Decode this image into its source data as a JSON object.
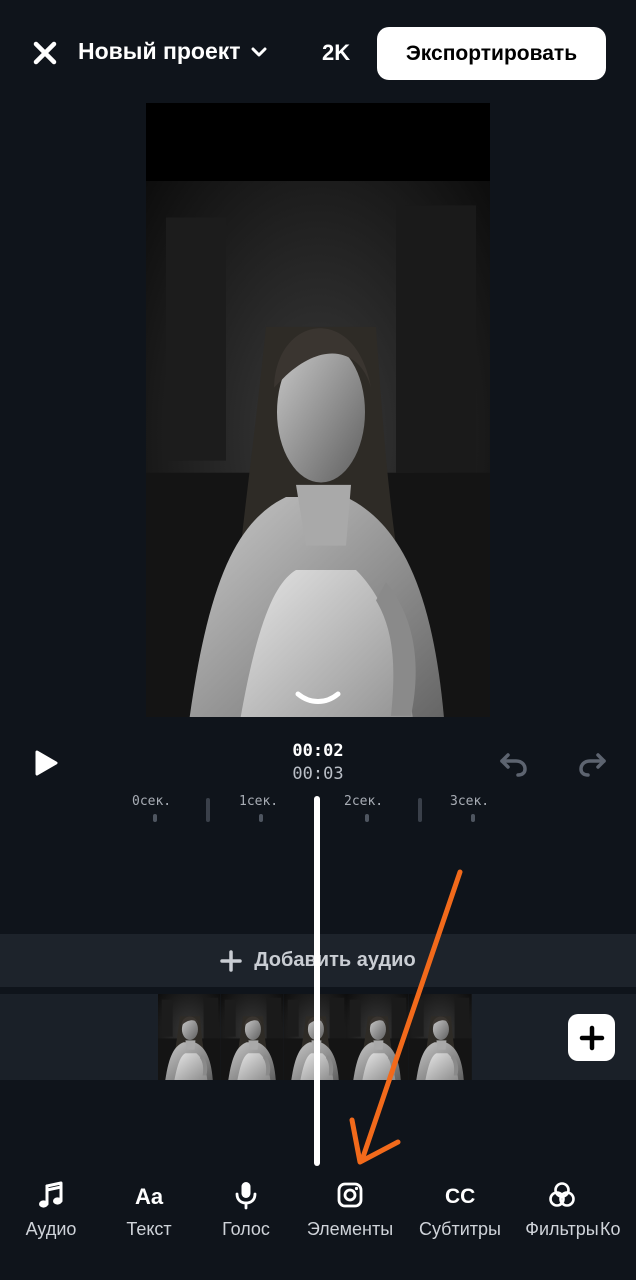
{
  "header": {
    "title": "Новый проект",
    "resolution": "2K",
    "export_label": "Экспортировать"
  },
  "playback": {
    "current_time": "00:02",
    "total_time": "00:03"
  },
  "timeline": {
    "ticks": [
      "0сек.",
      "1сек.",
      "2сек.",
      "3сек."
    ],
    "add_audio_label": "Добавить аудио",
    "clip_frames": 5
  },
  "toolbar": {
    "items": [
      {
        "label": "Аудио",
        "icon": "music-note-icon"
      },
      {
        "label": "Текст",
        "icon": "text-aa-icon"
      },
      {
        "label": "Голос",
        "icon": "microphone-icon"
      },
      {
        "label": "Элементы",
        "icon": "instagram-icon"
      },
      {
        "label": "Субтитры",
        "icon": "cc-icon"
      },
      {
        "label": "Фильтры",
        "icon": "filters-icon"
      },
      {
        "label": "Ко",
        "icon": ""
      }
    ]
  },
  "colors": {
    "background": "#0f141b",
    "accent_arrow": "#f26a1b",
    "export_button": "#ffffff"
  }
}
